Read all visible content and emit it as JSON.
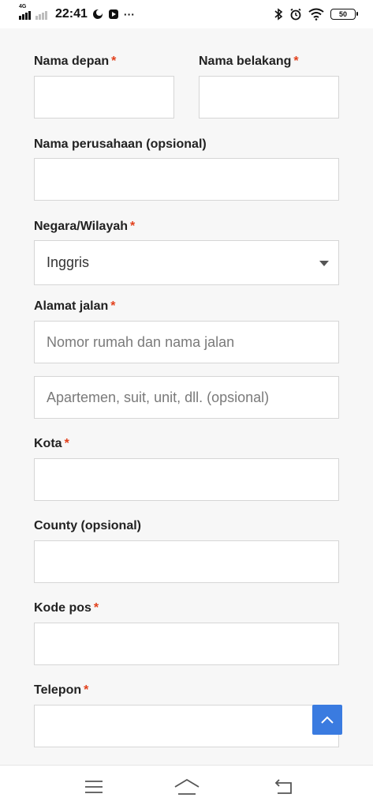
{
  "status_bar": {
    "network": "4G",
    "time": "22:41",
    "battery": "50",
    "more": "···"
  },
  "form": {
    "first_name": {
      "label": "Nama depan",
      "required": "*",
      "value": ""
    },
    "last_name": {
      "label": "Nama belakang",
      "required": "*",
      "value": ""
    },
    "company": {
      "label": "Nama perusahaan (opsional)",
      "value": ""
    },
    "country": {
      "label": "Negara/Wilayah",
      "required": "*",
      "selected": "Inggris"
    },
    "street": {
      "label": "Alamat jalan",
      "required": "*",
      "placeholder1": "Nomor rumah dan nama jalan",
      "placeholder2": "Apartemen, suit, unit, dll. (opsional)"
    },
    "city": {
      "label": "Kota",
      "required": "*",
      "value": ""
    },
    "county": {
      "label": "County (opsional)",
      "value": ""
    },
    "postcode": {
      "label": "Kode pos",
      "required": "*",
      "value": ""
    },
    "phone": {
      "label": "Telepon",
      "required": "*",
      "value": ""
    }
  },
  "colors": {
    "required": "#e2401c",
    "back_to_top": "#3a7be0"
  }
}
